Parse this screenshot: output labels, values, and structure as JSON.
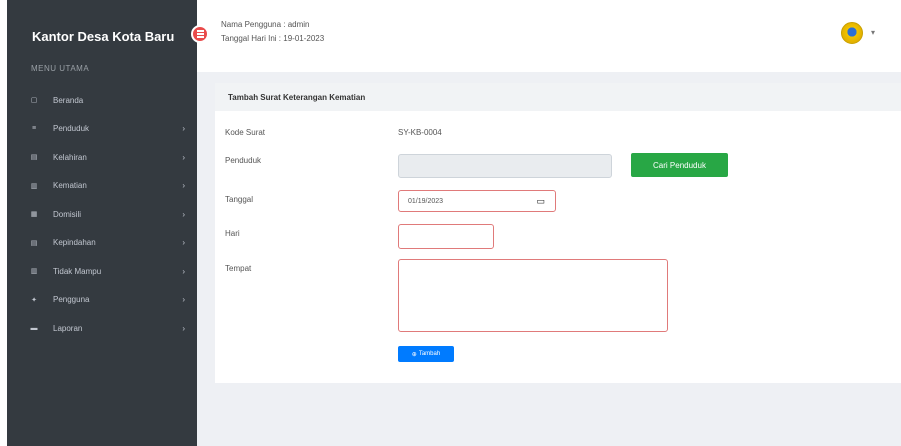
{
  "sidebar": {
    "brand": "Kantor Desa Kota Baru",
    "menu_header": "MENU UTAMA",
    "items": [
      {
        "label": "Beranda",
        "icon": "home-icon",
        "glyph": "▢",
        "has_submenu": false
      },
      {
        "label": "Penduduk",
        "icon": "users-icon",
        "glyph": "≡",
        "has_submenu": true
      },
      {
        "label": "Kelahiran",
        "icon": "baby-icon",
        "glyph": "▤",
        "has_submenu": true
      },
      {
        "label": "Kematian",
        "icon": "cross-icon",
        "glyph": "▥",
        "has_submenu": true
      },
      {
        "label": "Domisili",
        "icon": "house-icon",
        "glyph": "▦",
        "has_submenu": true
      },
      {
        "label": "Kepindahan",
        "icon": "truck-icon",
        "glyph": "▤",
        "has_submenu": true
      },
      {
        "label": "Tidak Mampu",
        "icon": "hand-icon",
        "glyph": "▥",
        "has_submenu": true
      },
      {
        "label": "Pengguna",
        "icon": "user-icon",
        "glyph": "✦",
        "has_submenu": true
      },
      {
        "label": "Laporan",
        "icon": "report-icon",
        "glyph": "▬",
        "has_submenu": true
      }
    ],
    "chevron": "›"
  },
  "topbar": {
    "user_line": "Nama Pengguna : admin",
    "date_line": "Tanggal Hari Ini : 19-01-2023",
    "logo_caret": "▾"
  },
  "form": {
    "title": "Tambah Surat Keterangan Kematian",
    "kode_label": "Kode Surat",
    "kode_value": "SY-KB-0004",
    "penduduk_label": "Penduduk",
    "cari_button": "Cari Penduduk",
    "tanggal_label": "Tanggal",
    "tanggal_value": "01/19/2023",
    "hari_label": "Hari",
    "tempat_label": "Tempat",
    "submit_label": "Tambah",
    "submit_icon": "⊕",
    "calendar_glyph": "▭"
  },
  "colors": {
    "sidebar_bg": "#343a40",
    "accent_green": "#28a745",
    "accent_blue": "#007bff",
    "required_border": "#e07a7a",
    "toggle_red": "#e94b4b"
  }
}
